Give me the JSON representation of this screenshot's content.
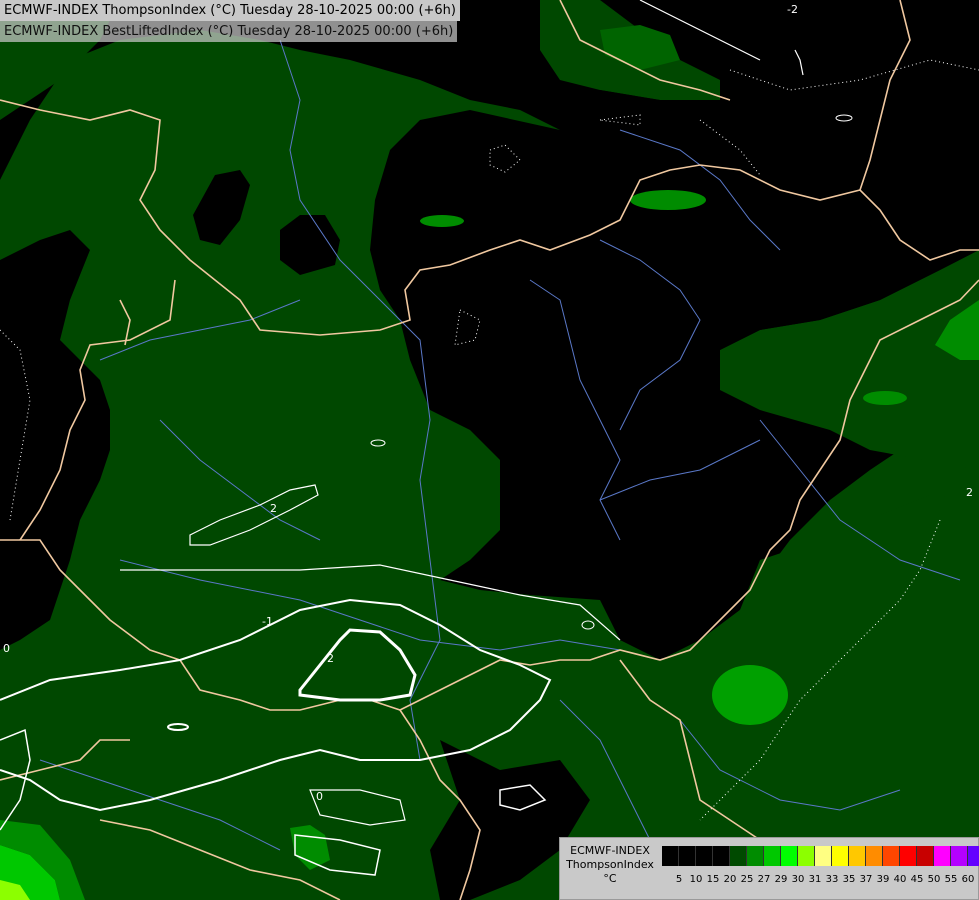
{
  "title": {
    "line1": "ECMWF-INDEX ThompsonIndex (°C) Tuesday 28-10-2025 00:00 (+6h)",
    "line2": "ECMWF-INDEX BestLiftedIndex (°C) Tuesday 28-10-2025 00:00 (+6h)"
  },
  "legend": {
    "line1": "ECMWF-INDEX",
    "line2": "ThompsonIndex",
    "line3": "°C",
    "ticks": [
      "5",
      "10",
      "15",
      "20",
      "25",
      "27",
      "29",
      "30",
      "31",
      "33",
      "35",
      "37",
      "39",
      "40",
      "45",
      "50",
      "55",
      "60"
    ],
    "colors": [
      "#000000",
      "#000000",
      "#000000",
      "#000000",
      "#004a00",
      "#008c00",
      "#00c800",
      "#00ff00",
      "#8cff00",
      "#ffff82",
      "#ffff00",
      "#ffc800",
      "#ff8c00",
      "#ff4600",
      "#ff0000",
      "#c80000",
      "#ff00ff",
      "#b400ff",
      "#6400ff",
      "#0000ff"
    ]
  },
  "colors": {
    "dark_green": "#004800",
    "mid_green": "#008c00",
    "bright_green": "#00c800",
    "lime": "#00ff00",
    "border": "#f0c8a0",
    "river": "#5a78c8",
    "contour": "#ffffff"
  },
  "contour_labels": [
    "-2",
    "-2",
    "-1",
    "0",
    "0",
    "2",
    "2"
  ]
}
